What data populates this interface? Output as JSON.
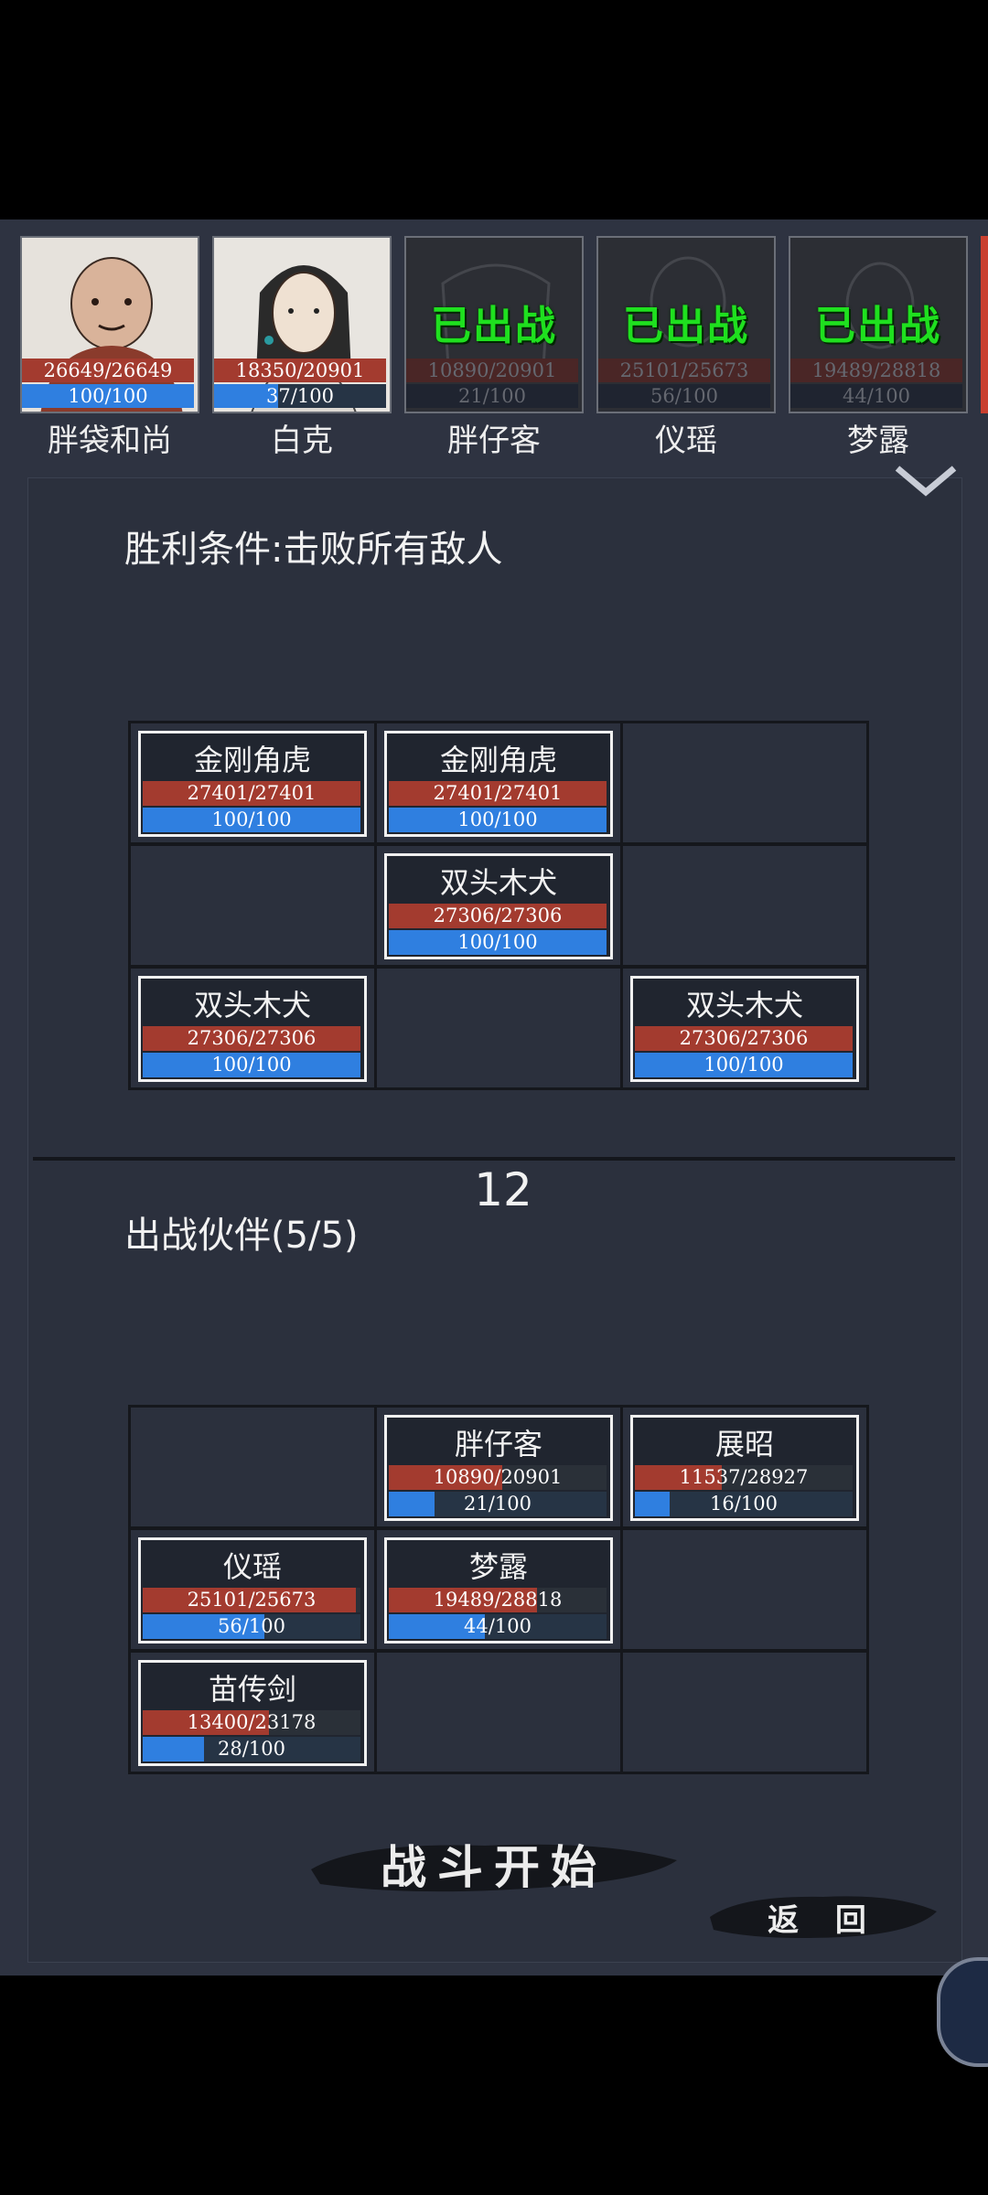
{
  "roster": [
    {
      "name": "胖袋和尚",
      "hp": "26649/26649",
      "mp": "100/100",
      "mp_fraction": 1.0,
      "deployed": false,
      "deployed_label": ""
    },
    {
      "name": "白克",
      "hp": "18350/20901",
      "mp": "37/100",
      "mp_fraction": 0.37,
      "deployed": false,
      "deployed_label": ""
    },
    {
      "name": "胖仔客",
      "hp": "10890/20901",
      "mp": "21/100",
      "mp_fraction": 0.21,
      "deployed": true,
      "deployed_label": "已出战"
    },
    {
      "name": "仪瑶",
      "hp": "25101/25673",
      "mp": "56/100",
      "mp_fraction": 0.56,
      "deployed": true,
      "deployed_label": "已出战"
    },
    {
      "name": "梦露",
      "hp": "19489/28818",
      "mp": "44/100",
      "mp_fraction": 0.44,
      "deployed": true,
      "deployed_label": "已出战"
    }
  ],
  "victory": {
    "title": "胜利条件:击败所有敌人"
  },
  "enemy_grid": [
    {
      "name": "金刚角虎",
      "hp": "27401/27401",
      "hp_fraction": 1.0,
      "mp": "100/100",
      "mp_fraction": 1.0
    },
    {
      "name": "金刚角虎",
      "hp": "27401/27401",
      "hp_fraction": 1.0,
      "mp": "100/100",
      "mp_fraction": 1.0
    },
    null,
    null,
    {
      "name": "双头木犬",
      "hp": "27306/27306",
      "hp_fraction": 1.0,
      "mp": "100/100",
      "mp_fraction": 1.0
    },
    null,
    {
      "name": "双头木犬",
      "hp": "27306/27306",
      "hp_fraction": 1.0,
      "mp": "100/100",
      "mp_fraction": 1.0
    },
    null,
    {
      "name": "双头木犬",
      "hp": "27306/27306",
      "hp_fraction": 1.0,
      "mp": "100/100",
      "mp_fraction": 1.0
    }
  ],
  "turn_counter": "12",
  "party": {
    "title": "出战伙伴(5/5)"
  },
  "party_grid": [
    null,
    {
      "name": "胖仔客",
      "hp": "10890/20901",
      "hp_fraction": 0.52,
      "mp": "21/100",
      "mp_fraction": 0.21
    },
    {
      "name": "展昭",
      "hp": "11537/28927",
      "hp_fraction": 0.4,
      "mp": "16/100",
      "mp_fraction": 0.16
    },
    {
      "name": "仪瑶",
      "hp": "25101/25673",
      "hp_fraction": 0.98,
      "mp": "56/100",
      "mp_fraction": 0.56
    },
    {
      "name": "梦露",
      "hp": "19489/28818",
      "hp_fraction": 0.68,
      "mp": "44/100",
      "mp_fraction": 0.44
    },
    null,
    {
      "name": "苗传剑",
      "hp": "13400/23178",
      "hp_fraction": 0.58,
      "mp": "28/100",
      "mp_fraction": 0.28
    },
    null,
    null
  ],
  "buttons": {
    "start": "战斗开始",
    "back": "返 回"
  },
  "icons": {
    "collapse": "chevron-down-icon",
    "corner": "menu-badge-icon"
  },
  "colors": {
    "hp": "#a33b2f",
    "mp": "#2f7fe0",
    "deployed": "#1fe01f",
    "background": "#2e3341"
  }
}
